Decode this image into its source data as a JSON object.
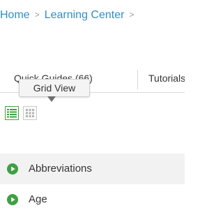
{
  "breadcrumb": {
    "items": [
      "Home",
      "Learning Center"
    ],
    "separator": ">"
  },
  "tabs": [
    {
      "label": "Quick Guides (66)"
    },
    {
      "label": "Tutorials"
    }
  ],
  "tooltip": {
    "text": "Grid View"
  },
  "view_toggle": {
    "list_icon": "list-view-icon",
    "grid_icon": "grid-view-icon",
    "active": "list"
  },
  "list": {
    "items": [
      {
        "label": "Abbreviations",
        "icon": "play-circle-icon"
      },
      {
        "label": "Age",
        "icon": "play-circle-icon"
      }
    ]
  },
  "colors": {
    "link": "#2f8ec9",
    "accent_green": "#3ea043",
    "text": "#333333",
    "row_shade": "#f2f2f2"
  }
}
